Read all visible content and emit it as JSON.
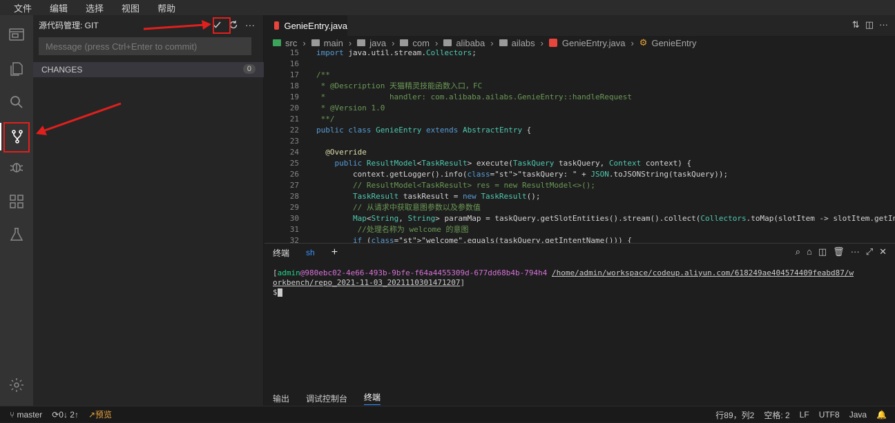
{
  "menu": [
    "文件",
    "编辑",
    "选择",
    "视图",
    "帮助"
  ],
  "sidebar": {
    "title": "源代码管理: GIT",
    "commit_placeholder": "Message (press Ctrl+Enter to commit)",
    "changes_label": "CHANGES",
    "changes_count": "0",
    "more_label": "···"
  },
  "editor": {
    "tab_label": "GenieEntry.java",
    "breadcrumb": [
      "src",
      "main",
      "java",
      "com",
      "alibaba",
      "ailabs",
      "GenieEntry.java",
      "GenieEntry"
    ],
    "lines": [
      {
        "n": "15",
        "t": "import java.util.stream.Collectors;"
      },
      {
        "n": "16",
        "t": ""
      },
      {
        "n": "17",
        "t": "/**"
      },
      {
        "n": "18",
        "t": " * @Description 天猫精灵技能函数入口，FC"
      },
      {
        "n": "19",
        "t": " *              handler: com.alibaba.ailabs.GenieEntry::handleRequest"
      },
      {
        "n": "20",
        "t": " * @Version 1.0"
      },
      {
        "n": "21",
        "t": " **/"
      },
      {
        "n": "22",
        "t": "public class GenieEntry extends AbstractEntry {"
      },
      {
        "n": "23",
        "t": ""
      },
      {
        "n": "24",
        "t": "  @Override"
      },
      {
        "n": "25",
        "t": "    public ResultModel<TaskResult> execute(TaskQuery taskQuery, Context context) {"
      },
      {
        "n": "26",
        "t": "        context.getLogger().info(\"taskQuery: \" + JSON.toJSONString(taskQuery));"
      },
      {
        "n": "27",
        "t": "        // ResultModel<TaskResult> res = new ResultModel<>();"
      },
      {
        "n": "28",
        "t": "        TaskResult taskResult = new TaskResult();"
      },
      {
        "n": "29",
        "t": "        // 从请求中获取意图参数以及参数值"
      },
      {
        "n": "30",
        "t": "        Map<String, String> paramMap = taskQuery.getSlotEntities().stream().collect(Collectors.toMap(slotItem -> slotItem.getIn"
      },
      {
        "n": "31",
        "t": "         //处理名称为 welcome 的意图"
      },
      {
        "n": "32",
        "t": "        if (\"welcome\".equals(taskQuery.getIntentName())) {"
      }
    ]
  },
  "panel": {
    "tab_terminal": "终端",
    "tab_sh": "sh",
    "add": "+",
    "term_user": "admin",
    "term_host": "@980ebc02-4e66-493b-9bfe-f64a4455309d-677dd68b4b-794h4",
    "term_path": "/home/admin/workspace/codeup.aliyun.com/618249ae404574409feabd87/w",
    "term_path2": "orkbench/repo_2021-11-03_2021110301471207",
    "term_bracket_open": "[",
    "term_bracket_close": "]",
    "prompt": "$"
  },
  "bottom_tabs": [
    "输出",
    "调试控制台",
    "终端"
  ],
  "status": {
    "branch": "master",
    "sync": "0↓ 2↑",
    "preview": "预览",
    "position": "行89，列2",
    "spaces": "空格: 2",
    "eol": "LF",
    "encoding": "UTF8",
    "lang": "Java"
  },
  "colors": {
    "accent": "#3794ff",
    "annotation": "#e0201c"
  }
}
